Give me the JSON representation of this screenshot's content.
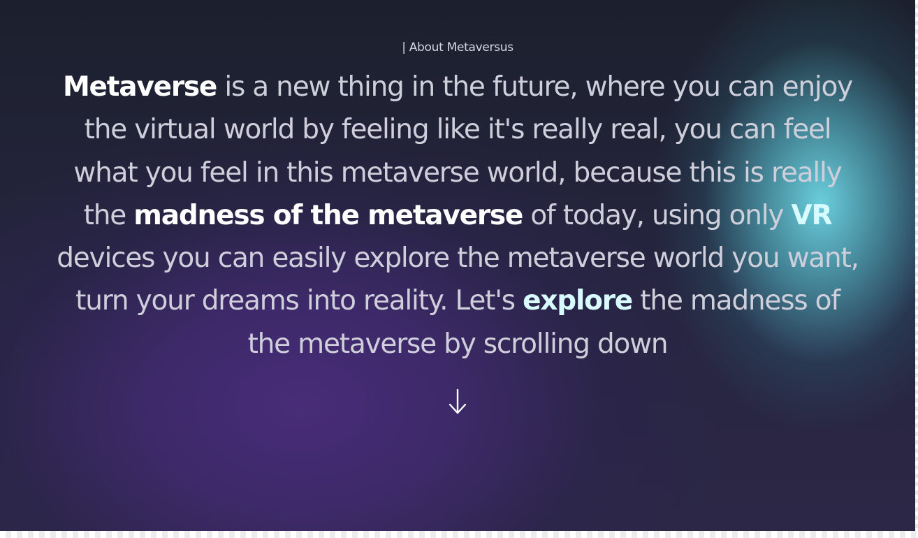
{
  "section": {
    "eyebrow": "| About Metaversus",
    "paragraph": [
      {
        "text": "Metaverse",
        "style": "bold"
      },
      {
        "text": " is a new thing in the future, where you can enjoy the virtual world by feeling like it's really real, you can feel what you feel in this metaverse world, because this is really the ",
        "style": "normal"
      },
      {
        "text": "madness of the metaverse",
        "style": "bold"
      },
      {
        "text": " of today, using only ",
        "style": "normal"
      },
      {
        "text": "VR",
        "style": "bold-cyan"
      },
      {
        "text": " devices you can easily explore the metaverse world you want, turn your dreams into reality. Let's ",
        "style": "normal"
      },
      {
        "text": "explore",
        "style": "bold-cyan"
      },
      {
        "text": " the madness of the metaverse by scrolling down",
        "style": "normal"
      }
    ],
    "scroll_arrow_icon": "arrow-down-icon"
  },
  "colors": {
    "background": "#1a1d2b",
    "purple_glow": "#482c78",
    "cyan_glow": "#6ed7e4",
    "body_text": "#cfcfdc",
    "highlight_white": "#ffffff",
    "highlight_cyan": "#d8fbff"
  }
}
